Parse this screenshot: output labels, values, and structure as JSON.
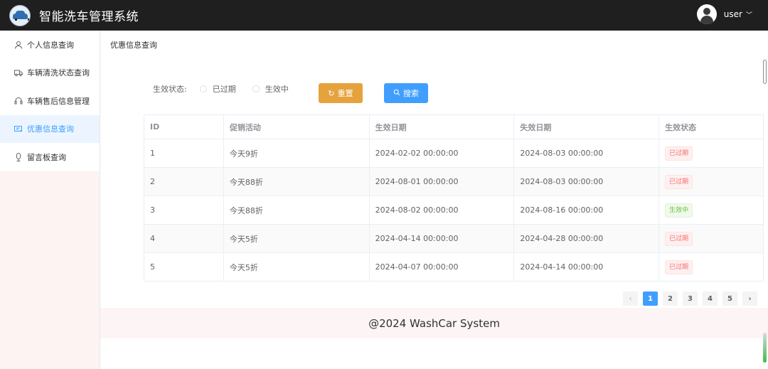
{
  "header": {
    "title": "智能洗车管理系统",
    "username": "user",
    "caret": "﹀"
  },
  "sidebar": {
    "items": [
      {
        "label": "个人信息查询",
        "icon": "user-icon"
      },
      {
        "label": "车辆清洗状态查询",
        "icon": "truck-icon"
      },
      {
        "label": "车辆售后信息管理",
        "icon": "headset-icon"
      },
      {
        "label": "优惠信息查询",
        "icon": "coupon-icon",
        "active": true
      },
      {
        "label": "留言板查询",
        "icon": "microphone-icon"
      }
    ]
  },
  "breadcrumb": "优惠信息查询",
  "filter": {
    "label": "生效状态:",
    "options": [
      "已过期",
      "生效中"
    ],
    "reset_label": "重置",
    "search_label": "搜索"
  },
  "table": {
    "columns": [
      "ID",
      "促销活动",
      "生效日期",
      "失效日期",
      "生效状态"
    ],
    "rows": [
      {
        "id": "1",
        "activity": "今天9折",
        "start": "2024-02-02 00:00:00",
        "end": "2024-08-03 00:00:00",
        "status": "已过期",
        "status_type": "danger"
      },
      {
        "id": "2",
        "activity": "今天88折",
        "start": "2024-08-01 00:00:00",
        "end": "2024-08-03 00:00:00",
        "status": "已过期",
        "status_type": "danger"
      },
      {
        "id": "3",
        "activity": "今天88折",
        "start": "2024-08-02 00:00:00",
        "end": "2024-08-16 00:00:00",
        "status": "生效中",
        "status_type": "success"
      },
      {
        "id": "4",
        "activity": "今天5折",
        "start": "2024-04-14 00:00:00",
        "end": "2024-04-28 00:00:00",
        "status": "已过期",
        "status_type": "danger"
      },
      {
        "id": "5",
        "activity": "今天5折",
        "start": "2024-04-07 00:00:00",
        "end": "2024-04-14 00:00:00",
        "status": "已过期",
        "status_type": "danger"
      }
    ]
  },
  "pagination": {
    "prev": "‹",
    "next": "›",
    "pages": [
      "1",
      "2",
      "3",
      "4",
      "5"
    ],
    "current": "1"
  },
  "footer": "@2024 WashCar System",
  "colors": {
    "primary": "#409eff",
    "warning": "#e6a23c",
    "danger": "#f56c6c",
    "success": "#67c23a",
    "header_bg": "#1f1f1f"
  }
}
